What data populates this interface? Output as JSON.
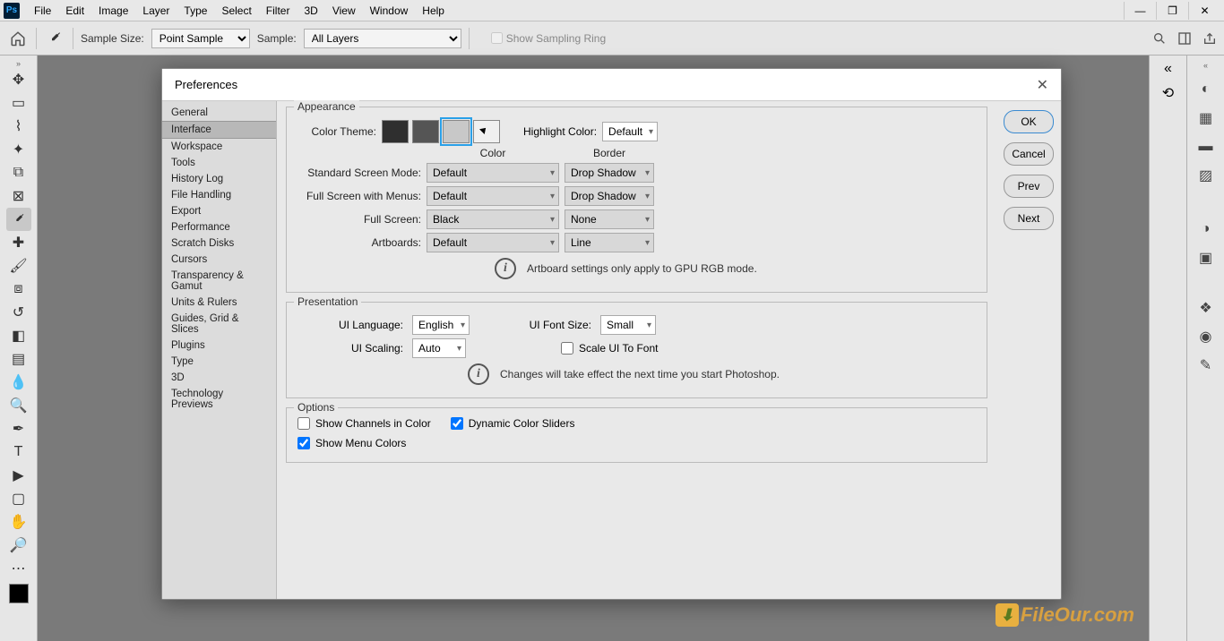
{
  "menu": {
    "items": [
      "File",
      "Edit",
      "Image",
      "Layer",
      "Type",
      "Select",
      "Filter",
      "3D",
      "View",
      "Window",
      "Help"
    ]
  },
  "optbar": {
    "sample_size_label": "Sample Size:",
    "sample_size_value": "Point Sample",
    "sample_label": "Sample:",
    "sample_value": "All Layers",
    "show_sampling": "Show Sampling Ring"
  },
  "dialog": {
    "title": "Preferences",
    "categories": [
      "General",
      "Interface",
      "Workspace",
      "Tools",
      "History Log",
      "File Handling",
      "Export",
      "Performance",
      "Scratch Disks",
      "Cursors",
      "Transparency & Gamut",
      "Units & Rulers",
      "Guides, Grid & Slices",
      "Plugins",
      "Type",
      "3D",
      "Technology Previews"
    ],
    "active_category_index": 1,
    "buttons": {
      "ok": "OK",
      "cancel": "Cancel",
      "prev": "Prev",
      "next": "Next"
    },
    "appearance": {
      "legend": "Appearance",
      "color_theme_label": "Color Theme:",
      "theme_swatches": [
        "#2f2f2f",
        "#555555",
        "#c8c8c8",
        "#f0f0f0"
      ],
      "selected_theme": 2,
      "highlight_label": "Highlight Color:",
      "highlight_value": "Default",
      "col_header_color": "Color",
      "col_header_border": "Border",
      "rows": [
        {
          "label": "Standard Screen Mode:",
          "color": "Default",
          "border": "Drop Shadow"
        },
        {
          "label": "Full Screen with Menus:",
          "color": "Default",
          "border": "Drop Shadow"
        },
        {
          "label": "Full Screen:",
          "color": "Black",
          "border": "None"
        },
        {
          "label": "Artboards:",
          "color": "Default",
          "border": "Line"
        }
      ],
      "note": "Artboard settings only apply to GPU RGB mode."
    },
    "presentation": {
      "legend": "Presentation",
      "ui_lang_label": "UI Language:",
      "ui_lang_value": "English",
      "ui_font_label": "UI Font Size:",
      "ui_font_value": "Small",
      "ui_scaling_label": "UI Scaling:",
      "ui_scaling_value": "Auto",
      "scale_to_font": "Scale UI To Font",
      "note": "Changes will take effect the next time you start Photoshop."
    },
    "options": {
      "legend": "Options",
      "show_channels": "Show Channels in Color",
      "dynamic_sliders": "Dynamic Color Sliders",
      "show_menu_colors": "Show Menu Colors"
    }
  },
  "watermark": "FileOur.com"
}
